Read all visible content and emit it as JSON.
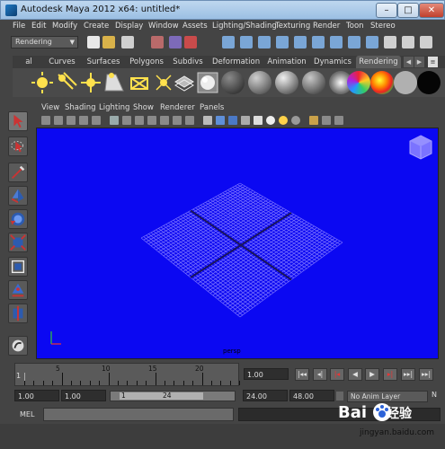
{
  "window": {
    "title": "Autodesk Maya 2012 x64: untitled*"
  },
  "menu": [
    "File",
    "Edit",
    "Modify",
    "Create",
    "Display",
    "Window",
    "Assets",
    "Lighting/Shading",
    "Texturing",
    "Render",
    "Toon",
    "Stereo"
  ],
  "statusline": {
    "mode": "Rendering"
  },
  "shelf": {
    "tabs": [
      "al",
      "Curves",
      "Surfaces",
      "Polygons",
      "Subdivs",
      "Deformation",
      "Animation",
      "Dynamics",
      "Rendering"
    ],
    "active_tab": "Rendering",
    "icons": [
      "ambient-light-icon",
      "directional-light-icon",
      "point-light-icon",
      "spot-light-icon",
      "area-light-icon",
      "volume-light-icon",
      "camera-icon",
      "image-plane-icon",
      "blinn-sphere-icon",
      "lambert-sphere-icon",
      "phong-sphere-icon",
      "phonge-sphere-icon",
      "anisotropic-sphere-icon",
      "layered-sphere-icon",
      "ramp-sphere-icon",
      "gray-sphere-icon",
      "black-sphere-icon"
    ]
  },
  "panel": {
    "menus": [
      "View",
      "Shading",
      "Lighting",
      "Show",
      "Renderer",
      "Panels"
    ],
    "camera_label": "persp"
  },
  "timeline": {
    "ticks": [
      "5",
      "10",
      "15",
      "20"
    ],
    "current_frame_label": "1",
    "current_frame": "1.00",
    "range_start": "1.00",
    "range_start_inner": "1.00",
    "range_bar_start": "1",
    "range_bar_end": "24",
    "range_end": "24.00",
    "anim_end": "48.00",
    "anim_layer": "No Anim Layer",
    "buttons": [
      "|◂◂",
      "◂|",
      "|◂",
      "◀",
      "▶",
      "▸|",
      "▸▸|",
      "▸▸|"
    ]
  },
  "command": {
    "label": "MEL"
  },
  "watermark": {
    "brand_a": "Bai",
    "brand_b": "经验",
    "url": "jingyan.baidu.com"
  },
  "colors": {
    "viewport": "#0b08f2",
    "grid": "#7c74ff",
    "accent": "#c33"
  }
}
